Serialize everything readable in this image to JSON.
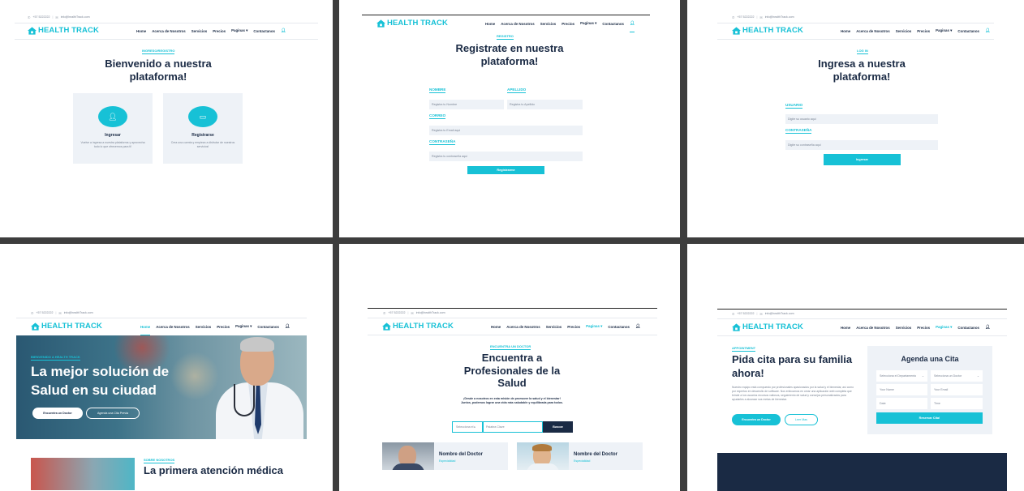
{
  "brand": {
    "name": "HEALTH TRACK",
    "accent": "#17c1d6",
    "dark": "#1a2a44"
  },
  "topbar": {
    "phone": "+57 5222222",
    "email": "info@healthTrack.com",
    "separator": "|"
  },
  "nav": {
    "items": [
      "Home",
      "Acerca de Nosotros",
      "Servicios",
      "Precios",
      "Paginas ▾",
      "Contactanos"
    ],
    "user_icon": "user-icon"
  },
  "panel1": {
    "eyebrow": "INGRESO/REGISTRO",
    "title_line1": "Bienvenido a nuestra",
    "title_line2": "plataforma!",
    "cards": [
      {
        "icon": "user-icon",
        "title": "Ingresar",
        "desc": "Vuelve a ingresa a nuestra plataforma y aprovecha todo lo que ofrecemos para ti!"
      },
      {
        "icon": "id-card-icon",
        "title": "Registrarse",
        "desc": "Crea una cuenta y empieza a disfrutar de nuestros servicios!"
      }
    ]
  },
  "panel2": {
    "eyebrow": "REGISTRO",
    "title_line1": "Registrate en nuestra",
    "title_line2": "plataforma!",
    "fields": {
      "nombre_label": "NOMBRE",
      "nombre_ph": "Registra tu Nombre",
      "apellido_label": "APELLIDO",
      "apellido_ph": "Registra tu Apellido",
      "correo_label": "CORREO",
      "correo_ph": "Registra tu Email aqui",
      "pass_label": "CONTRASEÑA",
      "pass_ph": "Registra tu contraseña aqui"
    },
    "submit": "Registrarme"
  },
  "panel3": {
    "eyebrow": "LOG IN",
    "title_line1": "Ingresa a nuestra",
    "title_line2": "plataforma!",
    "user_label": "USUARIO",
    "user_ph": "Digite su usuario aqui",
    "pass_label": "CONTRASEÑA",
    "pass_ph": "Digite su contraseña aqui",
    "submit": "Ingresar"
  },
  "panel4": {
    "eyebrow": "BIENVENIDO A HEALTH TRACK",
    "title": "La mejor solución de Salud en su ciudad",
    "btn_primary": "Encuentra un Doctor",
    "btn_secondary": "Agenda una Cita Previa",
    "about_eyebrow": "SOBRE NOSOTROS",
    "about_title": "La primera atención médica"
  },
  "panel5": {
    "eyebrow": "ENCUENTRA UN DOCTOR",
    "title_line1": "Encuentra a",
    "title_line2": "Profesionales de la",
    "title_line3": "Salud",
    "desc": "¡Desde a nosotros en esta misión de promover la salud y el bienestar! Juntos, podemos lograr una vida más saludable y equilibrada para todos.",
    "select": "Selecciona el ▸",
    "search_ph": "Palabra Clave",
    "search_btn": "Buscar",
    "doctors": [
      {
        "name": "Nombre del Doctor",
        "specialty": "Especialidad"
      },
      {
        "name": "Nombre del Doctor",
        "specialty": "Especialidad"
      }
    ]
  },
  "panel6": {
    "eyebrow": "APPOINTMENT",
    "title_line1": "Pida cita para su familia",
    "title_line2": "ahora!",
    "desc": "Nuestro equipo está compuesto por profesionales apasionados por la salud y el bienestar, así como por expertos en desarrollo de software. Nos enfocamos en crear una aplicación web completa que brinde a los usuarios recursos valiosos, seguimiento de salud y consejos personalizados para ayudarles a alcanzar sus metas de bienestar.",
    "btn_primary": "Encuentra un Doctor",
    "btn_secondary": "Leer Mas",
    "form_title": "Agenda una Cita",
    "dept": "Selecciona el Departamento",
    "doctor": "Selecciona un Doctor",
    "name_ph": "Your Name",
    "email_ph": "Your Email",
    "date_ph": "Date",
    "time_ph": "Time",
    "submit": "Reservar Cita!"
  }
}
